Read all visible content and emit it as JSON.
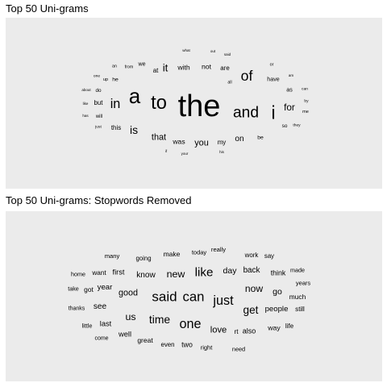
{
  "chart_data": [
    {
      "type": "wordcloud",
      "title": "Top 50 Uni-grams",
      "words": [
        {
          "text": "the",
          "weight": 100
        },
        {
          "text": "a",
          "weight": 68
        },
        {
          "text": "to",
          "weight": 62
        },
        {
          "text": "i",
          "weight": 60
        },
        {
          "text": "and",
          "weight": 50
        },
        {
          "text": "of",
          "weight": 46
        },
        {
          "text": "in",
          "weight": 42
        },
        {
          "text": "is",
          "weight": 36
        },
        {
          "text": "it",
          "weight": 34
        },
        {
          "text": "for",
          "weight": 30
        },
        {
          "text": "that",
          "weight": 28
        },
        {
          "text": "you",
          "weight": 28
        },
        {
          "text": "on",
          "weight": 26
        },
        {
          "text": "was",
          "weight": 22
        },
        {
          "text": "with",
          "weight": 22
        },
        {
          "text": "not",
          "weight": 22
        },
        {
          "text": "are",
          "weight": 20
        },
        {
          "text": "at",
          "weight": 20
        },
        {
          "text": "but",
          "weight": 20
        },
        {
          "text": "this",
          "weight": 20
        },
        {
          "text": "my",
          "weight": 20
        },
        {
          "text": "have",
          "weight": 18
        },
        {
          "text": "as",
          "weight": 18
        },
        {
          "text": "we",
          "weight": 18
        },
        {
          "text": "he",
          "weight": 17
        },
        {
          "text": "be",
          "weight": 17
        },
        {
          "text": "so",
          "weight": 16
        },
        {
          "text": "do",
          "weight": 16
        },
        {
          "text": "will",
          "weight": 15
        },
        {
          "text": "me",
          "weight": 14
        },
        {
          "text": "up",
          "weight": 14
        },
        {
          "text": "from",
          "weight": 13
        },
        {
          "text": "an",
          "weight": 13
        },
        {
          "text": "all",
          "weight": 13
        },
        {
          "text": "or",
          "weight": 13
        },
        {
          "text": "by",
          "weight": 12
        },
        {
          "text": "can",
          "weight": 12
        },
        {
          "text": "they",
          "weight": 12
        },
        {
          "text": "just",
          "weight": 12
        },
        {
          "text": "one",
          "weight": 12
        },
        {
          "text": "about",
          "weight": 11
        },
        {
          "text": "like",
          "weight": 11
        },
        {
          "text": "has",
          "weight": 11
        },
        {
          "text": "what",
          "weight": 11
        },
        {
          "text": "out",
          "weight": 11
        },
        {
          "text": "said",
          "weight": 11
        },
        {
          "text": "am",
          "weight": 11
        },
        {
          "text": "if",
          "weight": 11
        },
        {
          "text": "your",
          "weight": 11
        },
        {
          "text": "his",
          "weight": 11
        }
      ]
    },
    {
      "type": "wordcloud",
      "title": "Top 50 Uni-grams: Stopwords Removed",
      "words": [
        {
          "text": "said",
          "weight": 100
        },
        {
          "text": "can",
          "weight": 98
        },
        {
          "text": "just",
          "weight": 95
        },
        {
          "text": "one",
          "weight": 95
        },
        {
          "text": "like",
          "weight": 88
        },
        {
          "text": "time",
          "weight": 80
        },
        {
          "text": "get",
          "weight": 78
        },
        {
          "text": "new",
          "weight": 70
        },
        {
          "text": "us",
          "weight": 70
        },
        {
          "text": "now",
          "weight": 68
        },
        {
          "text": "love",
          "weight": 62
        },
        {
          "text": "good",
          "weight": 60
        },
        {
          "text": "day",
          "weight": 58
        },
        {
          "text": "go",
          "weight": 58
        },
        {
          "text": "know",
          "weight": 55
        },
        {
          "text": "see",
          "weight": 55
        },
        {
          "text": "back",
          "weight": 54
        },
        {
          "text": "year",
          "weight": 52
        },
        {
          "text": "people",
          "weight": 52
        },
        {
          "text": "first",
          "weight": 50
        },
        {
          "text": "last",
          "weight": 50
        },
        {
          "text": "well",
          "weight": 50
        },
        {
          "text": "also",
          "weight": 48
        },
        {
          "text": "think",
          "weight": 47
        },
        {
          "text": "two",
          "weight": 47
        },
        {
          "text": "way",
          "weight": 46
        },
        {
          "text": "make",
          "weight": 45
        },
        {
          "text": "great",
          "weight": 45
        },
        {
          "text": "got",
          "weight": 44
        },
        {
          "text": "much",
          "weight": 44
        },
        {
          "text": "want",
          "weight": 43
        },
        {
          "text": "rt",
          "weight": 43
        },
        {
          "text": "life",
          "weight": 42
        },
        {
          "text": "still",
          "weight": 42
        },
        {
          "text": "even",
          "weight": 41
        },
        {
          "text": "work",
          "weight": 41
        },
        {
          "text": "say",
          "weight": 40
        },
        {
          "text": "going",
          "weight": 40
        },
        {
          "text": "many",
          "weight": 39
        },
        {
          "text": "really",
          "weight": 39
        },
        {
          "text": "today",
          "weight": 38
        },
        {
          "text": "years",
          "weight": 38
        },
        {
          "text": "right",
          "weight": 38
        },
        {
          "text": "little",
          "weight": 37
        },
        {
          "text": "need",
          "weight": 37
        },
        {
          "text": "made",
          "weight": 36
        },
        {
          "text": "home",
          "weight": 36
        },
        {
          "text": "take",
          "weight": 36
        },
        {
          "text": "thanks",
          "weight": 35
        },
        {
          "text": "come",
          "weight": 35
        }
      ]
    }
  ]
}
